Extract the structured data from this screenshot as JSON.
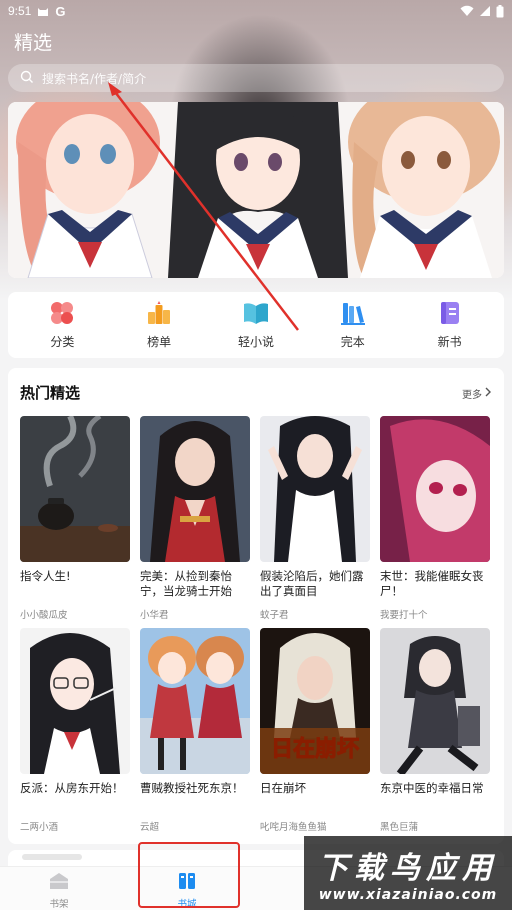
{
  "status_bar": {
    "time": "9:51",
    "notification_icons": [
      "cat-icon",
      "google-icon"
    ],
    "system_icons": [
      "wifi-icon",
      "signal-icon",
      "battery-icon"
    ]
  },
  "header": {
    "title": "精选",
    "search_placeholder": "搜索书名/作者/简介"
  },
  "categories": [
    {
      "label": "分类",
      "icon": "grid-icon",
      "color": "#f05a5a"
    },
    {
      "label": "榜单",
      "icon": "ranking-icon",
      "color": "#f5a623"
    },
    {
      "label": "轻小说",
      "icon": "open-book-icon",
      "color": "#3fb6d6"
    },
    {
      "label": "完本",
      "icon": "books-icon",
      "color": "#2f8ff0"
    },
    {
      "label": "新书",
      "icon": "new-book-icon",
      "color": "#8a6cf0"
    }
  ],
  "hot_section": {
    "title": "热门精选",
    "more_label": "更多"
  },
  "books": [
    {
      "title": "指令人生!",
      "author": "小小酸瓜皮"
    },
    {
      "title": "完美：从捡到秦怡宁，当龙骑士开始",
      "author": "小华君"
    },
    {
      "title": "假装沦陷后，她们露出了真面目",
      "author": "蚊子君"
    },
    {
      "title": "末世：我能催眠女丧尸！",
      "author": "我要打十个"
    },
    {
      "title": "反派：从房东开始！",
      "author": "二两小酒"
    },
    {
      "title": "曹贼教授社死东京！",
      "author": "云超"
    },
    {
      "title": "日在崩坏",
      "author": "叱咤月海鱼鱼猫"
    },
    {
      "title": "东京中医的幸福日常",
      "author": "黑色巨蒲"
    }
  ],
  "cover_texts": {
    "book7_logo": "日在崩坏"
  },
  "bottom_nav": {
    "bookshelf_label": "书架",
    "bookstore_label": "书城"
  },
  "watermark": {
    "line1": "下载鸟应用",
    "line2": "www.xiazainiao.com"
  },
  "colors": {
    "accent": "#1d8cf0",
    "annotation": "#e0312b"
  }
}
